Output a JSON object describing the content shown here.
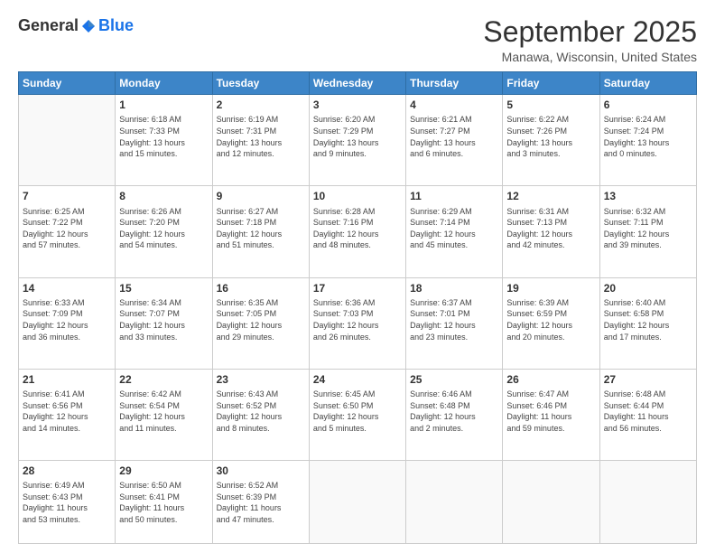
{
  "logo": {
    "general": "General",
    "blue": "Blue"
  },
  "title": "September 2025",
  "location": "Manawa, Wisconsin, United States",
  "days_header": [
    "Sunday",
    "Monday",
    "Tuesday",
    "Wednesday",
    "Thursday",
    "Friday",
    "Saturday"
  ],
  "weeks": [
    [
      {
        "day": "",
        "data": ""
      },
      {
        "day": "1",
        "data": "Sunrise: 6:18 AM\nSunset: 7:33 PM\nDaylight: 13 hours\nand 15 minutes."
      },
      {
        "day": "2",
        "data": "Sunrise: 6:19 AM\nSunset: 7:31 PM\nDaylight: 13 hours\nand 12 minutes."
      },
      {
        "day": "3",
        "data": "Sunrise: 6:20 AM\nSunset: 7:29 PM\nDaylight: 13 hours\nand 9 minutes."
      },
      {
        "day": "4",
        "data": "Sunrise: 6:21 AM\nSunset: 7:27 PM\nDaylight: 13 hours\nand 6 minutes."
      },
      {
        "day": "5",
        "data": "Sunrise: 6:22 AM\nSunset: 7:26 PM\nDaylight: 13 hours\nand 3 minutes."
      },
      {
        "day": "6",
        "data": "Sunrise: 6:24 AM\nSunset: 7:24 PM\nDaylight: 13 hours\nand 0 minutes."
      }
    ],
    [
      {
        "day": "7",
        "data": "Sunrise: 6:25 AM\nSunset: 7:22 PM\nDaylight: 12 hours\nand 57 minutes."
      },
      {
        "day": "8",
        "data": "Sunrise: 6:26 AM\nSunset: 7:20 PM\nDaylight: 12 hours\nand 54 minutes."
      },
      {
        "day": "9",
        "data": "Sunrise: 6:27 AM\nSunset: 7:18 PM\nDaylight: 12 hours\nand 51 minutes."
      },
      {
        "day": "10",
        "data": "Sunrise: 6:28 AM\nSunset: 7:16 PM\nDaylight: 12 hours\nand 48 minutes."
      },
      {
        "day": "11",
        "data": "Sunrise: 6:29 AM\nSunset: 7:14 PM\nDaylight: 12 hours\nand 45 minutes."
      },
      {
        "day": "12",
        "data": "Sunrise: 6:31 AM\nSunset: 7:13 PM\nDaylight: 12 hours\nand 42 minutes."
      },
      {
        "day": "13",
        "data": "Sunrise: 6:32 AM\nSunset: 7:11 PM\nDaylight: 12 hours\nand 39 minutes."
      }
    ],
    [
      {
        "day": "14",
        "data": "Sunrise: 6:33 AM\nSunset: 7:09 PM\nDaylight: 12 hours\nand 36 minutes."
      },
      {
        "day": "15",
        "data": "Sunrise: 6:34 AM\nSunset: 7:07 PM\nDaylight: 12 hours\nand 33 minutes."
      },
      {
        "day": "16",
        "data": "Sunrise: 6:35 AM\nSunset: 7:05 PM\nDaylight: 12 hours\nand 29 minutes."
      },
      {
        "day": "17",
        "data": "Sunrise: 6:36 AM\nSunset: 7:03 PM\nDaylight: 12 hours\nand 26 minutes."
      },
      {
        "day": "18",
        "data": "Sunrise: 6:37 AM\nSunset: 7:01 PM\nDaylight: 12 hours\nand 23 minutes."
      },
      {
        "day": "19",
        "data": "Sunrise: 6:39 AM\nSunset: 6:59 PM\nDaylight: 12 hours\nand 20 minutes."
      },
      {
        "day": "20",
        "data": "Sunrise: 6:40 AM\nSunset: 6:58 PM\nDaylight: 12 hours\nand 17 minutes."
      }
    ],
    [
      {
        "day": "21",
        "data": "Sunrise: 6:41 AM\nSunset: 6:56 PM\nDaylight: 12 hours\nand 14 minutes."
      },
      {
        "day": "22",
        "data": "Sunrise: 6:42 AM\nSunset: 6:54 PM\nDaylight: 12 hours\nand 11 minutes."
      },
      {
        "day": "23",
        "data": "Sunrise: 6:43 AM\nSunset: 6:52 PM\nDaylight: 12 hours\nand 8 minutes."
      },
      {
        "day": "24",
        "data": "Sunrise: 6:45 AM\nSunset: 6:50 PM\nDaylight: 12 hours\nand 5 minutes."
      },
      {
        "day": "25",
        "data": "Sunrise: 6:46 AM\nSunset: 6:48 PM\nDaylight: 12 hours\nand 2 minutes."
      },
      {
        "day": "26",
        "data": "Sunrise: 6:47 AM\nSunset: 6:46 PM\nDaylight: 11 hours\nand 59 minutes."
      },
      {
        "day": "27",
        "data": "Sunrise: 6:48 AM\nSunset: 6:44 PM\nDaylight: 11 hours\nand 56 minutes."
      }
    ],
    [
      {
        "day": "28",
        "data": "Sunrise: 6:49 AM\nSunset: 6:43 PM\nDaylight: 11 hours\nand 53 minutes."
      },
      {
        "day": "29",
        "data": "Sunrise: 6:50 AM\nSunset: 6:41 PM\nDaylight: 11 hours\nand 50 minutes."
      },
      {
        "day": "30",
        "data": "Sunrise: 6:52 AM\nSunset: 6:39 PM\nDaylight: 11 hours\nand 47 minutes."
      },
      {
        "day": "",
        "data": ""
      },
      {
        "day": "",
        "data": ""
      },
      {
        "day": "",
        "data": ""
      },
      {
        "day": "",
        "data": ""
      }
    ]
  ]
}
